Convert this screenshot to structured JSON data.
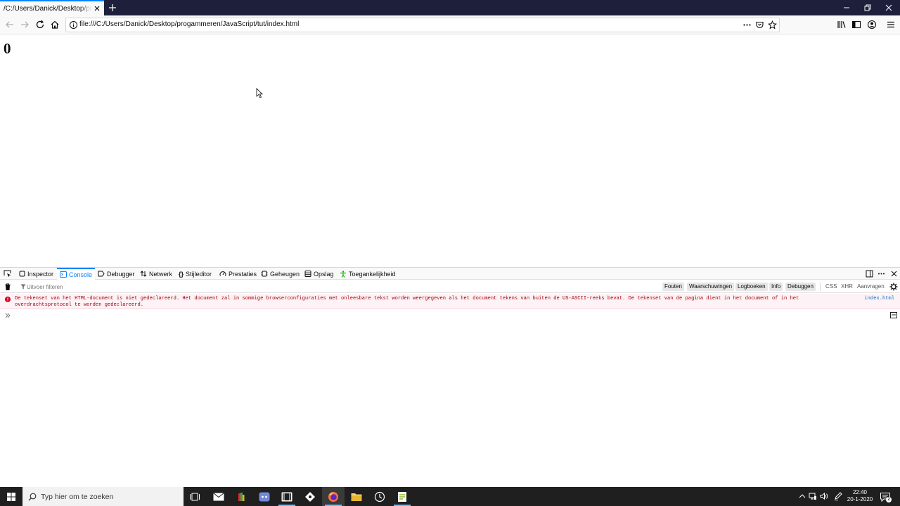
{
  "browser": {
    "tab": {
      "title": "/C:/Users/Danick/Desktop/progammeren/JavaScript/tut/index.html"
    },
    "url": "file:///C:/Users/Danick/Desktop/progammeren/JavaScript/tut/index.html"
  },
  "page": {
    "heading": "0"
  },
  "devtools": {
    "tabs": [
      {
        "label": "Inspector",
        "icon": "inspector-icon"
      },
      {
        "label": "Console",
        "icon": "console-icon",
        "selected": true
      },
      {
        "label": "Debugger",
        "icon": "debugger-icon"
      },
      {
        "label": "Netwerk",
        "icon": "network-icon"
      },
      {
        "label": "Stijleditor",
        "icon": "style-editor-icon"
      },
      {
        "label": "Prestaties",
        "icon": "performance-icon"
      },
      {
        "label": "Geheugen",
        "icon": "memory-icon"
      },
      {
        "label": "Opslag",
        "icon": "storage-icon"
      },
      {
        "label": "Toegankelijkheid",
        "icon": "accessibility-icon"
      }
    ],
    "filter": {
      "placeholder": "Uitvoer filteren",
      "levels": [
        "Fouten",
        "Waarschuwingen",
        "Logboeken",
        "Info",
        "Debuggen"
      ],
      "types": [
        "CSS",
        "XHR",
        "Aanvragen"
      ]
    },
    "messages": [
      {
        "level": "error",
        "text": "De tekenset van het HTML-document is niet gedeclareerd. Het document zal in sommige browserconfiguraties met onleesbare tekst worden weergegeven als het document tekens van buiten de US-ASCII-reeks bevat. De tekenset van de pagina dient in het document of in het overdrachtsprotocol te worden gedeclareerd.",
        "source": "index.html"
      }
    ]
  },
  "taskbar": {
    "search_placeholder": "Typ hier om te zoeken",
    "time": "22:40",
    "date": "20-1-2020",
    "notification_count": "2"
  },
  "colors": {
    "accent": "#0a84ff",
    "error_text": "#a4000f",
    "error_bg": "#fdf2f5",
    "titlebar": "#1e1f3a",
    "taskbar": "#1f1f1f"
  }
}
